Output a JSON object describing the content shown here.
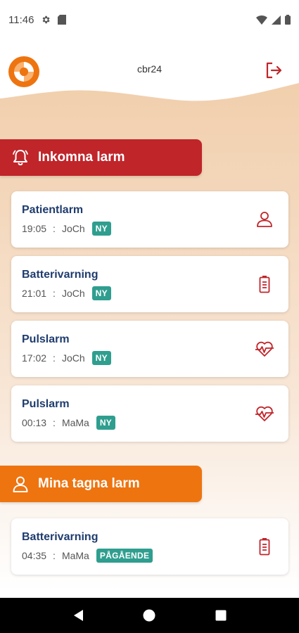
{
  "status_bar": {
    "time": "11:46",
    "icons": [
      "gear-icon",
      "sd-card-icon",
      "wifi-icon",
      "signal-icon",
      "battery-icon"
    ]
  },
  "header": {
    "title": "cbr24",
    "logo": "app-logo",
    "logout_icon": "logout-icon"
  },
  "colors": {
    "incoming_header": "#c0252a",
    "mine_header": "#ee7410",
    "title_text": "#1f3c6e",
    "badge": "#2f9e8f",
    "alert_icon": "#c0252a"
  },
  "incoming": {
    "label": "Inkomna larm",
    "icon": "bell-icon",
    "alarms": [
      {
        "title": "Patientlarm",
        "time": "19:05",
        "sep": ":",
        "user": "JoCh",
        "badge": "NY",
        "icon": "person-icon"
      },
      {
        "title": "Batterivarning",
        "time": "21:01",
        "sep": ":",
        "user": "JoCh",
        "badge": "NY",
        "icon": "battery-alert-icon"
      },
      {
        "title": "Pulslarm",
        "time": "17:02",
        "sep": ":",
        "user": "JoCh",
        "badge": "NY",
        "icon": "heart-pulse-icon"
      },
      {
        "title": "Pulslarm",
        "time": "00:13",
        "sep": ":",
        "user": "MaMa",
        "badge": "NY",
        "icon": "heart-pulse-icon"
      }
    ]
  },
  "mine": {
    "label": "Mina tagna larm",
    "icon": "person-icon",
    "alarms": [
      {
        "title": "Batterivarning",
        "time": "04:35",
        "sep": ":",
        "user": "MaMa",
        "badge": "PÅGÅENDE",
        "icon": "battery-alert-icon"
      }
    ]
  },
  "nav": {
    "back": "back-icon",
    "home": "home-icon",
    "recents": "recents-icon"
  }
}
